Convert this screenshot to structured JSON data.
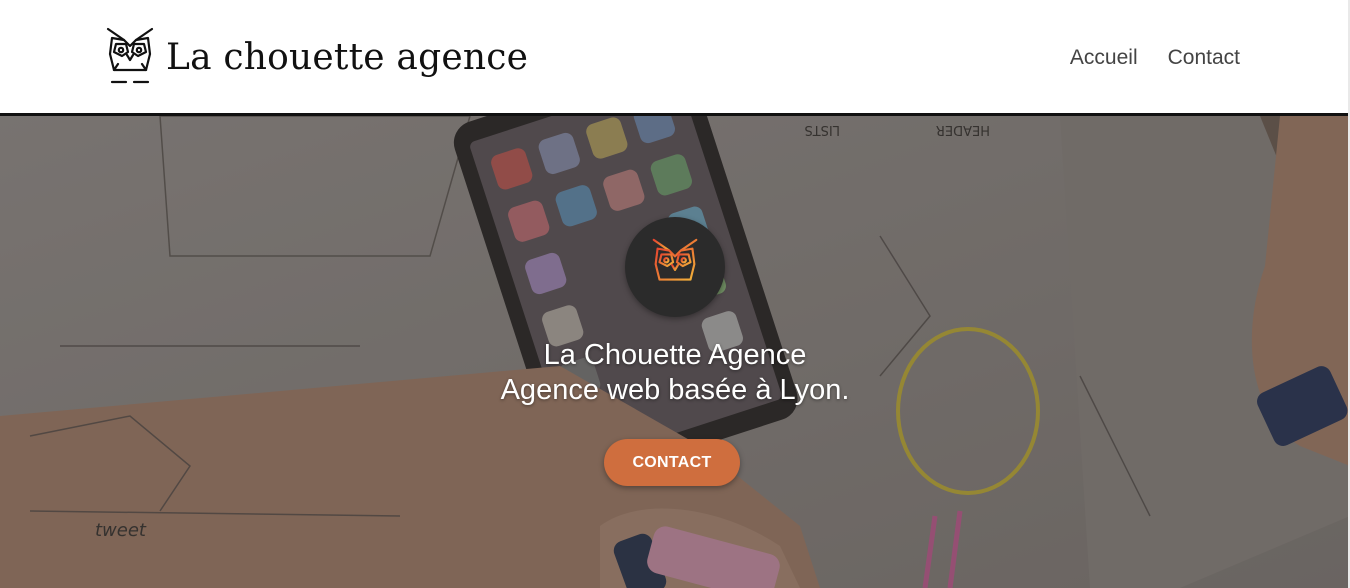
{
  "header": {
    "brand_name": "La chouette agence",
    "nav": [
      {
        "label": "Accueil"
      },
      {
        "label": "Contact"
      }
    ]
  },
  "hero": {
    "title": "La Chouette Agence",
    "subtitle": "Agence web basée à Lyon.",
    "cta_label": "CONTACT",
    "logo_icon": "owl-icon"
  },
  "colors": {
    "accent": "#cf6e3e",
    "header_border": "#111111",
    "logo_circle": "#2b2b2b",
    "owl_gradient_start": "#e6452f",
    "owl_gradient_end": "#f2b33a"
  }
}
